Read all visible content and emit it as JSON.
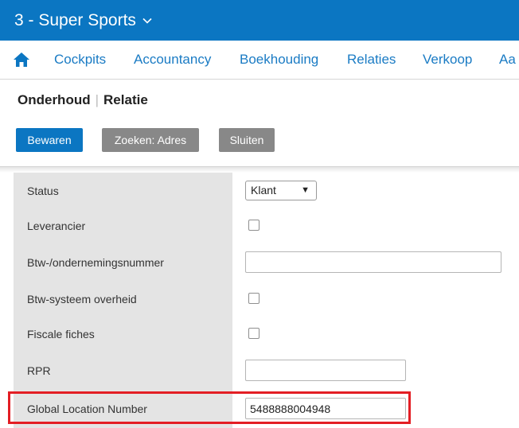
{
  "header": {
    "company": "3 - Super Sports",
    "icons": {
      "dropdown": "chevron-down-icon"
    }
  },
  "nav": {
    "home_icon": "home-icon",
    "items": [
      {
        "label": "Cockpits"
      },
      {
        "label": "Accountancy"
      },
      {
        "label": "Boekhouding"
      },
      {
        "label": "Relaties"
      },
      {
        "label": "Verkoop"
      },
      {
        "label": "Aa"
      }
    ]
  },
  "page": {
    "heading_part1": "Onderhoud",
    "heading_separator": "|",
    "heading_part2": "Relatie"
  },
  "toolbar": {
    "save_label": "Bewaren",
    "search_label": "Zoeken: Adres",
    "close_label": "Sluiten"
  },
  "form": {
    "status": {
      "label": "Status",
      "value": "Klant",
      "arrow": "▼"
    },
    "leverancier": {
      "label": "Leverancier",
      "checked": false
    },
    "btw_nummer": {
      "label": "Btw-/ondernemingsnummer",
      "value": ""
    },
    "btw_systeem": {
      "label": "Btw-systeem overheid",
      "checked": false
    },
    "fiscale_fiches": {
      "label": "Fiscale fiches",
      "checked": false
    },
    "rpr": {
      "label": "RPR",
      "value": ""
    },
    "gln": {
      "label": "Global Location Number",
      "value": "5488888004948"
    }
  },
  "colors": {
    "primary": "#0b76c2",
    "nav_link": "#1a7bc4",
    "secondary_button": "#888888",
    "label_panel": "#e4e4e4",
    "highlight": "#e31e24"
  }
}
